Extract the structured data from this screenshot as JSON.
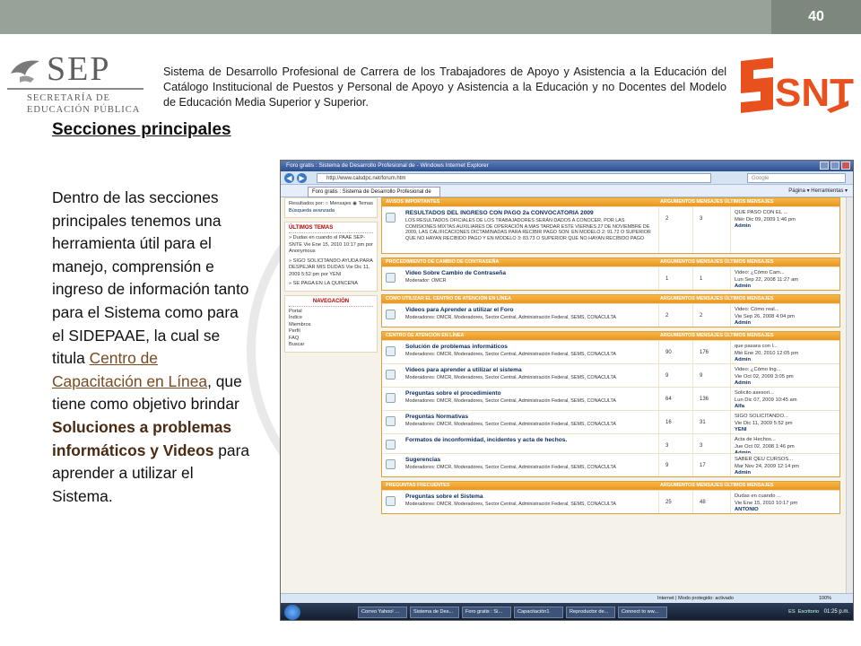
{
  "slide": {
    "page_number": "40",
    "header_text": "Sistema de Desarrollo Profesional de Carrera de los Trabajadores de Apoyo y Asistencia a la Educación  del Catálogo Institucional de Puestos y Personal de Apoyo y Asistencia a la Educación y no Docentes del Modelo de Educación Media Superior y Superior.",
    "sep_logo": {
      "abbr": "SEP",
      "line1": "SECRETARÍA DE",
      "line2": "EDUCACIÓN PÚBLICA"
    },
    "snte_logo": {
      "text": "SNTE",
      "color": "#e8501e"
    },
    "title": "Secciones principales",
    "body": {
      "part1": "Dentro de las secciones principales tenemos una herramienta útil para el manejo, comprensión e ingreso de información tanto para el Sistema como para el SIDEPAAE, la cual se titula ",
      "link": "Centro de Capacitación en Línea",
      "part2": ", que tiene como objetivo brindar ",
      "bold": "Soluciones a problemas informáticos y Videos",
      "part3": " para aprender a utilizar el Sistema."
    }
  },
  "browser": {
    "window_title": "Foro gratis : Sistema de Desarrollo Profesional de - Windows Internet Explorer",
    "url": "http://www.calsdpc.net/forum.htm",
    "search_placeholder": "Google",
    "tab_label": "Foro gratis : Sistema de Desarrollo Profesional de",
    "toolbar_text": "Página ▾  Herramientas ▾",
    "status_zone": "Internet | Modo protegido: activado",
    "zoom": "100%",
    "sidebar": {
      "search_options": "Resultados por:  ○ Mensajes  ◉ Temas",
      "advanced_search": "Búsqueda avanzada",
      "latest_heading": "ÚLTIMOS TEMAS",
      "latest_items": [
        "» Dudas en cuando el PAAE SEP-SNTE Vie Ene 15, 2010 10:17 pm por Anonymous",
        "» SIGO SOLICITANDO AYUDA PARA DESPEJAR MIS DUDAS Vie Dic 11, 2009 5:52 pm por YENI",
        "» SE PAGA EN LA QUINCENA"
      ],
      "nav_heading": "NAVEGACIÓN",
      "nav_items": [
        "Portal",
        "Índice",
        "Miembros",
        "Perfil",
        "FAQ",
        "Buscar"
      ]
    },
    "column_headers": "ARGUMENTOS  MENSAJES  ÚLTIMOS MENSAJES",
    "categories": [
      {
        "name": "AVISOS IMPORTANTES",
        "forums": [
          {
            "title": "RESULTADOS DEL INGRESO CON PAGO 2a CONVOCATORIA 2009",
            "desc": "LOS RESULTADOS OFICIALES DE LOS TRABAJADORES SERÁN DADOS A CONOCER, POR LAS COMISIONES MIXTAS AUXILIARES DE OPERACIÓN A MAS TARDAR ESTE VIERNES 27 DE NOVIEMBRE DE 2009, LAS CALIFICACIONES DICTAMINADAS PARA RECIBIR PAGO SON: EN MODELO 2: 91.72 O SUPERIOR QUE NO HAYAN RECIBIDO PAGO Y EN MODELO 3: 83.73 O SUPERIOR QUE NO HAYAN RECIBIDO PAGO",
            "topics": "2",
            "posts": "3",
            "last1": "QUE PASO CON EL ...",
            "last2": "Miér Dic 09, 2009 1:46 pm",
            "last3": "Admin"
          }
        ]
      },
      {
        "name": "PROCEDIMIENTO DE CAMBIO DE CONTRASEÑA",
        "forums": [
          {
            "title": "Video Sobre Cambio de Contraseña",
            "desc": "Moderador: OMCR",
            "topics": "1",
            "posts": "1",
            "last1": "Video: ¿Cómo Cam...",
            "last2": "Lun Sep 22, 2008 11:27 am",
            "last3": "Admin"
          }
        ]
      },
      {
        "name": "COMO UTILIZAR EL CENTRO DE ATENCIÓN EN LÍNEA",
        "forums": [
          {
            "title": "Videos para Aprender a utilizar el Foro",
            "desc": "Moderadores: OMCR, Moderadores, Sector Central, Administración Federal, SEMS, CONACULTA",
            "topics": "2",
            "posts": "2",
            "last1": "Video: Cómo real...",
            "last2": "Vie Sep 26, 2008 4:04 pm",
            "last3": "Admin"
          }
        ]
      },
      {
        "name": "CENTRO DE ATENCIÓN EN LÍNEA",
        "forums": [
          {
            "title": "Solución de problemas informáticos",
            "desc": "Moderadores: OMCR, Moderadores, Sector Central, Administración Federal, SEMS, CONACULTA",
            "topics": "90",
            "posts": "176",
            "last1": "que pasara con l...",
            "last2": "Mié Ene 20, 2010 12:05 pm",
            "last3": "Admin"
          },
          {
            "title": "Videos para aprender a utilizar el sistema",
            "desc": "Moderadores: OMCR, Moderadores, Sector Central, Administración Federal, SEMS, CONACULTA",
            "topics": "9",
            "posts": "9",
            "last1": "Video: ¿Cómo Ing...",
            "last2": "Vie Oct 02, 2009 3:05 pm",
            "last3": "Admin"
          },
          {
            "title": "Preguntas sobre el procedimiento",
            "desc": "Moderadores: OMCR, Moderadores, Sector Central, Administración Federal, SEMS, CONACULTA",
            "topics": "64",
            "posts": "136",
            "last1": "Solicito asesori...",
            "last2": "Lun Dic 07, 2009 10:45 am",
            "last3": "Alfa"
          },
          {
            "title": "Preguntas Normativas",
            "desc": "Moderadores: OMCR, Moderadores, Sector Central, Administración Federal, SEMS, CONACULTA",
            "topics": "16",
            "posts": "31",
            "last1": "SIGO SOLICITANDO...",
            "last2": "Vie Dic 11, 2009 5:52 pm",
            "last3": "YENI"
          },
          {
            "title": "Formatos de inconformidad, incidentes y acta de hechos.",
            "desc": "",
            "topics": "3",
            "posts": "3",
            "last1": "Acta de Hechos...",
            "last2": "Jue Oct 02, 2008 1:46 pm",
            "last3": "Admin"
          },
          {
            "title": "Sugerencias",
            "desc": "Moderadores: OMCR, Moderadores, Sector Central, Administración Federal, SEMS, CONACULTA",
            "topics": "9",
            "posts": "17",
            "last1": "SABER QEU CURSOS...",
            "last2": "Mar Nov 24, 2009 12:14 pm",
            "last3": "Admin"
          }
        ]
      },
      {
        "name": "PREGUNTAS FRECUENTES",
        "forums": [
          {
            "title": "Preguntas sobre el Sistema",
            "desc": "Moderadores: OMCR, Moderadores, Sector Central, Administración Federal, SEMS, CONACULTA",
            "topics": "25",
            "posts": "48",
            "last1": "Dudas en cuando ...",
            "last2": "Vie Ene 15, 2010 10:17 pm",
            "last3": "ANTONIO"
          }
        ]
      }
    ],
    "taskbar": {
      "tasks": [
        "Correo Yahoo! ...",
        "Sistema de Des...",
        "Foro gratis : Si...",
        "Capacitación1",
        "Reproductor de...",
        "Connect to ww..."
      ],
      "lang": "ES",
      "desktop": "Escritorio",
      "clock": "01:25 p.m."
    }
  }
}
